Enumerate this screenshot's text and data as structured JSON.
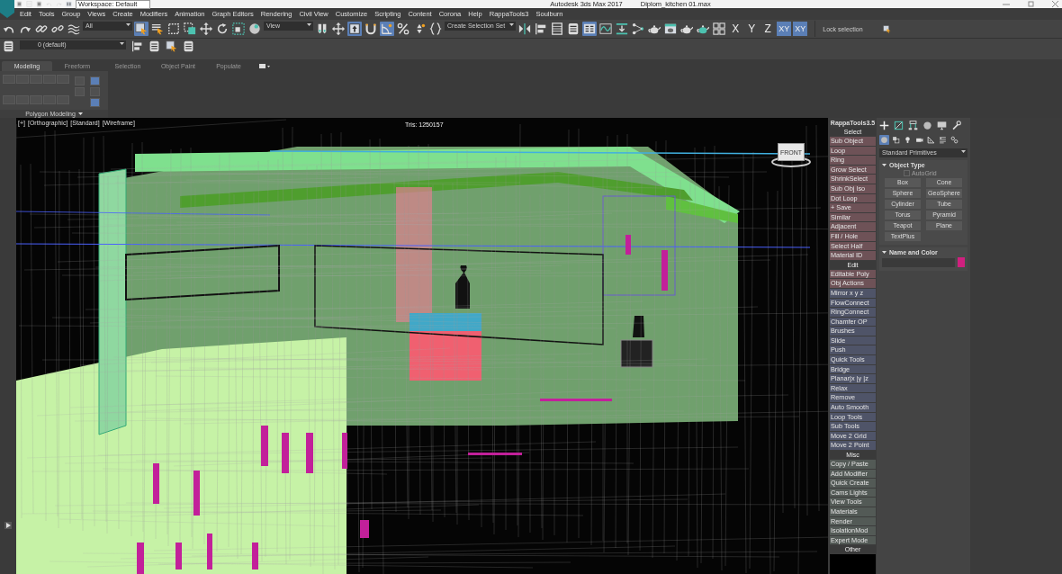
{
  "title_bar": {
    "workspace": "Workspace: Default",
    "app_title": "Autodesk 3ds Max 2017",
    "file_name": "Diplom_kitchen 01.max"
  },
  "menu_bar": [
    "Edit",
    "Tools",
    "Group",
    "Views",
    "Create",
    "Modifiers",
    "Animation",
    "Graph Editors",
    "Rendering",
    "Civil View",
    "Customize",
    "Scripting",
    "Content",
    "Corona",
    "Help",
    "RappaTools3",
    "Soulburn"
  ],
  "main_toolbar": [
    {
      "kind": "icon",
      "selected": false
    },
    {
      "kind": "icon",
      "selected": false
    },
    {
      "kind": "icon",
      "selected": false
    },
    {
      "kind": "icon",
      "selected": false
    },
    {
      "kind": "icon",
      "selected": false
    },
    {
      "kind": "dropdown",
      "value": "All"
    },
    {
      "kind": "icon",
      "selected": true
    },
    {
      "kind": "icon",
      "selected": false
    },
    {
      "kind": "icon",
      "selected": false
    },
    {
      "kind": "icon",
      "selected": false
    },
    {
      "kind": "icon",
      "selected": false
    },
    {
      "kind": "icon",
      "selected": false
    },
    {
      "kind": "icon",
      "selected": false
    },
    {
      "kind": "icon",
      "selected": false
    },
    {
      "kind": "dropdown",
      "value": "View"
    },
    {
      "kind": "icon",
      "selected": false
    },
    {
      "kind": "icon",
      "selected": false
    },
    {
      "kind": "icon",
      "selected": true
    },
    {
      "kind": "icon",
      "selected": false
    },
    {
      "kind": "icon",
      "selected": true
    },
    {
      "kind": "icon",
      "selected": false
    },
    {
      "kind": "icon",
      "selected": false
    },
    {
      "kind": "icon",
      "selected": false
    },
    {
      "kind": "dropdown",
      "value": "Create Selection Set"
    },
    {
      "kind": "icon",
      "selected": false
    },
    {
      "kind": "icon",
      "selected": false
    },
    {
      "kind": "icon",
      "selected": false
    },
    {
      "kind": "icon",
      "selected": false
    },
    {
      "kind": "icon",
      "selected": true
    },
    {
      "kind": "icon",
      "selected": false
    },
    {
      "kind": "icon",
      "selected": false
    },
    {
      "kind": "icon",
      "selected": false
    },
    {
      "kind": "icon",
      "selected": false
    },
    {
      "kind": "icon",
      "selected": false
    },
    {
      "kind": "icon",
      "selected": false
    },
    {
      "kind": "icon",
      "selected": false
    },
    {
      "kind": "icon",
      "selected": false
    },
    {
      "kind": "axis",
      "label": "X",
      "selected": false
    },
    {
      "kind": "axis",
      "label": "Y",
      "selected": false
    },
    {
      "kind": "axis",
      "label": "Z",
      "selected": false
    },
    {
      "kind": "axis",
      "label": "XY",
      "selected": true
    },
    {
      "kind": "axis",
      "label": "XY",
      "selected": true
    },
    {
      "kind": "lock",
      "label": "Lock selection"
    }
  ],
  "layer_toolbar": {
    "layer": "0 (default)"
  },
  "ribbon": {
    "tabs": [
      {
        "label": "Modeling",
        "selected": true
      },
      {
        "label": "Freeform",
        "selected": false
      },
      {
        "label": "Selection",
        "selected": false
      },
      {
        "label": "Object Paint",
        "selected": false
      },
      {
        "label": "Populate",
        "selected": false
      }
    ],
    "panel_title": "Polygon Modeling"
  },
  "viewport": {
    "labels": [
      "[+]",
      "[Orthographic]",
      "[Standard]",
      "[Wireframe]"
    ],
    "stats": "Tris: 1250157",
    "viewcube": "FRONT"
  },
  "rappatools": {
    "title": "RappaTools3.5",
    "sections": [
      {
        "header": "Select",
        "buttons": [
          {
            "label": "Sub Object",
            "color": "#6e5257"
          },
          {
            "label": "Loop",
            "color": "#6e5257"
          },
          {
            "label": "Ring",
            "color": "#6e5257"
          },
          {
            "label": "Grow Select",
            "color": "#6e5257"
          },
          {
            "label": "ShrinkSelect",
            "color": "#6e5257"
          },
          {
            "label": "Sub Obj Iso",
            "color": "#6e5257"
          },
          {
            "label": "Dot Loop",
            "color": "#6e5257"
          },
          {
            "label": "+ Save",
            "color": "#6e5257"
          },
          {
            "label": "Similar",
            "color": "#6e5257"
          },
          {
            "label": "Adjacent",
            "color": "#6e5257"
          },
          {
            "label": "Fill / Hole",
            "color": "#6e5257"
          },
          {
            "label": "Select Half",
            "color": "#6e5257"
          },
          {
            "label": "Material ID",
            "color": "#6e5257"
          }
        ]
      },
      {
        "header": "Edit",
        "buttons": [
          {
            "label": "Editable Poly",
            "color": "#6e5257"
          },
          {
            "label": "Obj Actions",
            "color": "#6e5257"
          },
          {
            "label": "Mirror  x  y  z",
            "color": "#4f5468"
          },
          {
            "label": "FlowConnect",
            "color": "#4f5468"
          },
          {
            "label": "RingConnect",
            "color": "#4f5468"
          },
          {
            "label": "Chamfer OP",
            "color": "#4f5468"
          },
          {
            "label": "Brushes",
            "color": "#4f5468"
          },
          {
            "label": "Slide",
            "color": "#4f5468"
          },
          {
            "label": "Push",
            "color": "#4f5468"
          },
          {
            "label": "Quick Tools",
            "color": "#4f5468"
          },
          {
            "label": "Bridge",
            "color": "#4f5468"
          },
          {
            "label": "Planar|x |y |z",
            "color": "#4f5468"
          },
          {
            "label": "Relax",
            "color": "#4f5468"
          },
          {
            "label": "Remove",
            "color": "#4f5468"
          },
          {
            "label": "Auto Smooth",
            "color": "#4f5468"
          },
          {
            "label": "Loop Tools",
            "color": "#4f5468"
          },
          {
            "label": "Sub Tools",
            "color": "#4f5468"
          },
          {
            "label": "Move 2 Grid",
            "color": "#4f5468"
          },
          {
            "label": "Move 2 Point",
            "color": "#4f5468"
          }
        ]
      },
      {
        "header": "Misc",
        "buttons": [
          {
            "label": "Copy / Paste",
            "color": "#535a56"
          },
          {
            "label": "Add Modifier",
            "color": "#535a56"
          },
          {
            "label": "Quick Create",
            "color": "#535a56"
          },
          {
            "label": "Cams Lights",
            "color": "#535a56"
          },
          {
            "label": "View Tools",
            "color": "#535a56"
          },
          {
            "label": "Materials",
            "color": "#535a56"
          },
          {
            "label": "Render",
            "color": "#535a56"
          },
          {
            "label": "IsolationMod",
            "color": "#535a56"
          },
          {
            "label": "Expert Mode",
            "color": "#535a56"
          }
        ]
      },
      {
        "header": "Other"
      }
    ]
  },
  "command_panel": {
    "categories": [
      {
        "selected": true
      },
      {
        "selected": false
      },
      {
        "selected": false
      },
      {
        "selected": false
      },
      {
        "selected": false
      },
      {
        "selected": false
      },
      {
        "selected": false
      }
    ],
    "dropdown": "Standard Primitives",
    "object_type": {
      "title": "Object Type",
      "autogrid": {
        "label": "AutoGrid",
        "checked": false,
        "disabled": true
      },
      "buttons": [
        "Box",
        "Cone",
        "Sphere",
        "GeoSphere",
        "Cylinder",
        "Tube",
        "Torus",
        "Pyramid",
        "Teapot",
        "Plane",
        "TextPlus"
      ]
    },
    "name_and_color": {
      "title": "Name and Color",
      "color": "#d0207f"
    }
  }
}
